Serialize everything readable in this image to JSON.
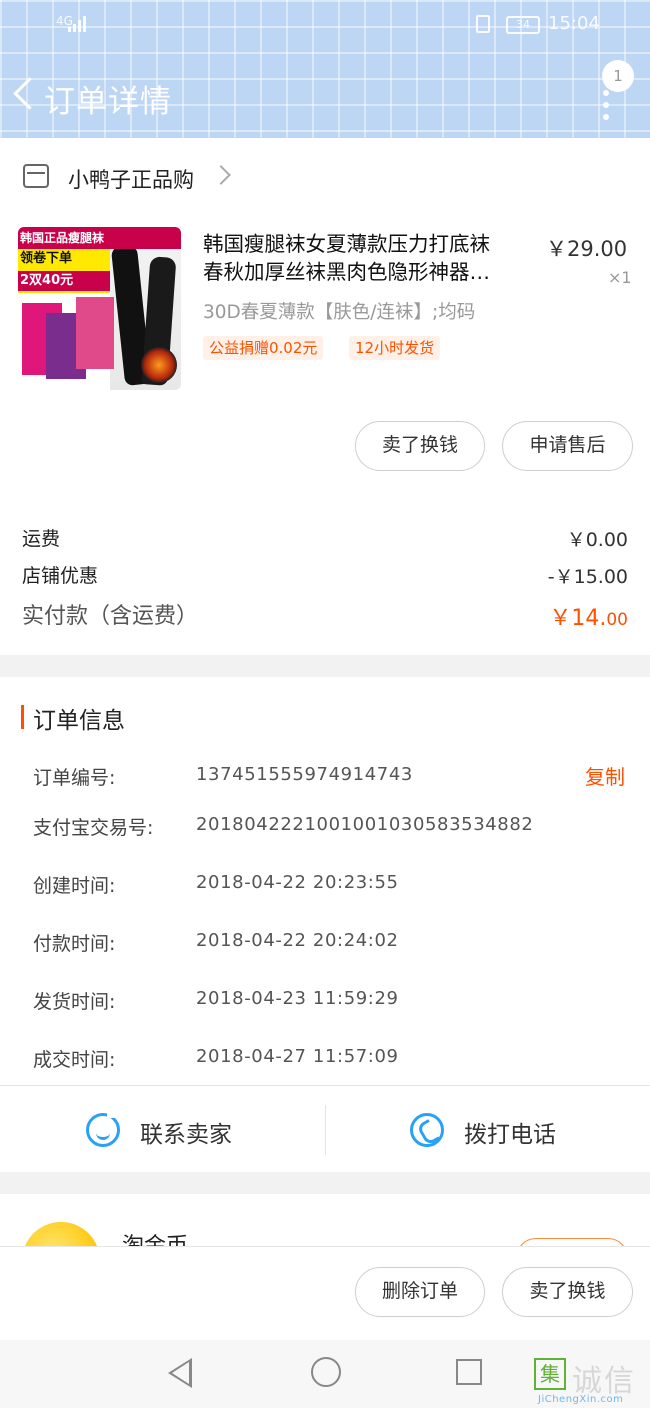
{
  "status_bar": {
    "network": "4G",
    "battery": "34",
    "time": "15:04"
  },
  "header": {
    "title": "订单详情",
    "badge_count": "1"
  },
  "shop": {
    "name": "小鸭子正品购"
  },
  "product": {
    "image_text_1": "韩国正品瘦腿袜",
    "image_text_2": "领卷下单",
    "image_text_3": "2双40元",
    "title_line1": "韩国瘦腿袜女夏薄款压力打底袜",
    "title_line2": "春秋加厚丝袜黑肉色隐形神器…",
    "price": "￥29.00",
    "quantity": "×1",
    "sku": "30D春夏薄款【肤色/连袜】;均码",
    "tags": [
      "公益捐赠0.02元",
      "12小时发货"
    ],
    "buttons": [
      "卖了换钱",
      "申请售后"
    ]
  },
  "fees": [
    {
      "label": "运费",
      "value": "￥0.00"
    },
    {
      "label": "店铺优惠",
      "value": "-￥15.00"
    }
  ],
  "paid": {
    "label": "实付款（含运费）",
    "value_main": "￥14.",
    "value_cents": "00"
  },
  "order_info": {
    "section_title": "订单信息",
    "copy_label": "复制",
    "rows": [
      {
        "label": "订单编号:",
        "value": "137451555974914743"
      },
      {
        "label": "支付宝交易号:",
        "value": "2018042221001001030583534882"
      },
      {
        "label": "创建时间:",
        "value": "2018-04-22 20:23:55"
      },
      {
        "label": "付款时间:",
        "value": "2018-04-22 20:24:02"
      },
      {
        "label": "发货时间:",
        "value": "2018-04-23 11:59:29"
      },
      {
        "label": "成交时间:",
        "value": "2018-04-27 11:57:09"
      }
    ],
    "actions": [
      "联系卖家",
      "拨打电话"
    ]
  },
  "coins": {
    "label": "淘金币"
  },
  "bottom_actions": [
    "删除订单",
    "卖了换钱"
  ],
  "watermark": {
    "mark": "集",
    "text": "诚信",
    "url": "JiChengXin.com"
  },
  "colors": {
    "accent": "#ff5000",
    "link_blue": "#29a1f7",
    "header_bg": "#bcd6f4"
  }
}
